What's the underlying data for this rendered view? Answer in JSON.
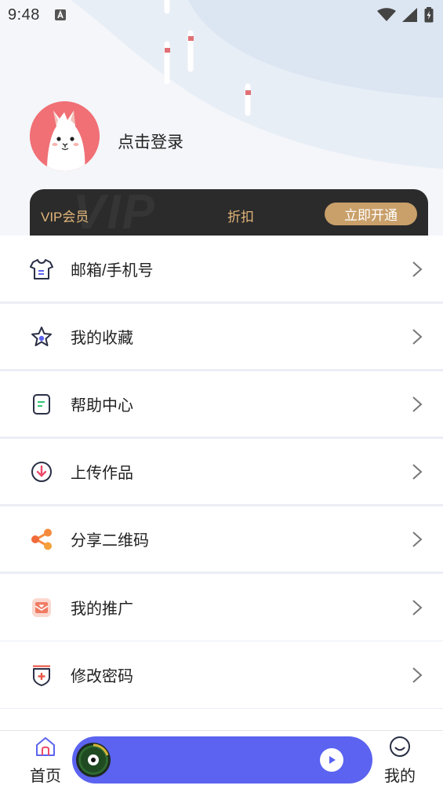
{
  "status_bar": {
    "time": "9:48"
  },
  "profile": {
    "login_text": "点击登录"
  },
  "vip_card": {
    "label": "VIP会员",
    "discount": "折扣",
    "button": "立即开通",
    "watermark": "VIP"
  },
  "menu": {
    "items": [
      {
        "label": "邮箱/手机号",
        "icon": "shirt-icon"
      },
      {
        "label": "我的收藏",
        "icon": "star-icon"
      },
      {
        "label": "帮助中心",
        "icon": "document-icon"
      },
      {
        "label": "上传作品",
        "icon": "upload-circle-icon"
      },
      {
        "label": "分享二维码",
        "icon": "share-icon"
      },
      {
        "label": "我的推广",
        "icon": "promotion-icon"
      },
      {
        "label": "修改密码",
        "icon": "shield-plus-icon"
      }
    ]
  },
  "tabbar": {
    "home_label": "首页",
    "mine_label": "我的"
  },
  "colors": {
    "vip_gold": "#e3b67a",
    "vip_button": "#c9a06a",
    "player_blue": "#5b63f0",
    "avatar_bg": "#f07075"
  }
}
